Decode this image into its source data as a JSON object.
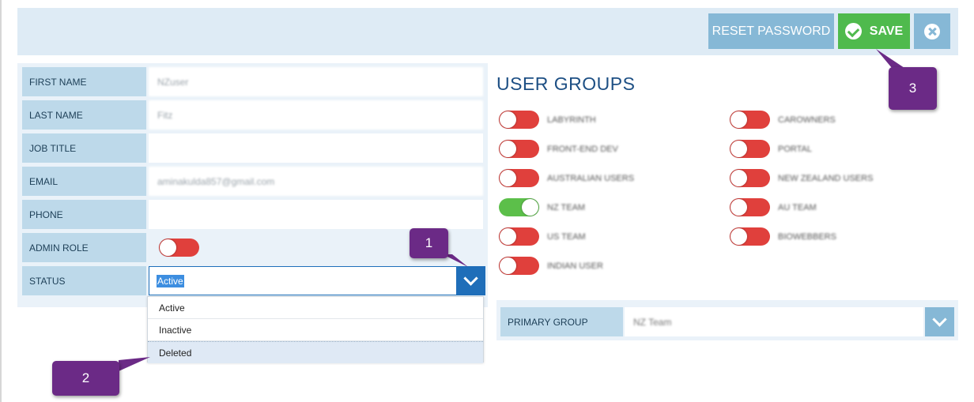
{
  "toolbar": {
    "reset_password_label": "RESET PASSWORD",
    "save_label": "SAVE"
  },
  "form": {
    "rows": [
      {
        "label": "FIRST NAME",
        "value": "NZuser"
      },
      {
        "label": "LAST NAME",
        "value": "Fitz"
      },
      {
        "label": "JOB TITLE",
        "value": ""
      },
      {
        "label": "EMAIL",
        "value": "aminakulda857@gmail.com"
      },
      {
        "label": "PHONE",
        "value": ""
      }
    ],
    "admin_role": {
      "label": "ADMIN ROLE",
      "enabled": false
    },
    "status": {
      "label": "STATUS",
      "selected": "Active",
      "options": [
        "Active",
        "Inactive",
        "Deleted"
      ],
      "highlighted_option": "Deleted"
    }
  },
  "user_groups": {
    "title": "USER GROUPS",
    "groups": [
      {
        "name": "LABYRINTH",
        "enabled": false
      },
      {
        "name": "CAROWNERS",
        "enabled": false
      },
      {
        "name": "FRONT-END DEV",
        "enabled": false
      },
      {
        "name": "PORTAL",
        "enabled": false
      },
      {
        "name": "AUSTRALIAN USERS",
        "enabled": false
      },
      {
        "name": "NEW ZEALAND USERS",
        "enabled": false
      },
      {
        "name": "NZ TEAM",
        "enabled": true
      },
      {
        "name": "AU TEAM",
        "enabled": false
      },
      {
        "name": "US TEAM",
        "enabled": false
      },
      {
        "name": "BIOWEBBERS",
        "enabled": false
      },
      {
        "name": "INDIAN USER",
        "enabled": false
      }
    ]
  },
  "primary_group": {
    "label": "PRIMARY GROUP",
    "value": "NZ Team"
  },
  "callouts": [
    "1",
    "2",
    "3"
  ],
  "colors": {
    "accent_blue": "#1f6eb9",
    "light_blue": "#86b8d6",
    "save_green": "#4fba4d",
    "toggle_off_red": "#e0403c",
    "toggle_on_green": "#5cbf4a",
    "callout_purple": "#6b2a86"
  }
}
